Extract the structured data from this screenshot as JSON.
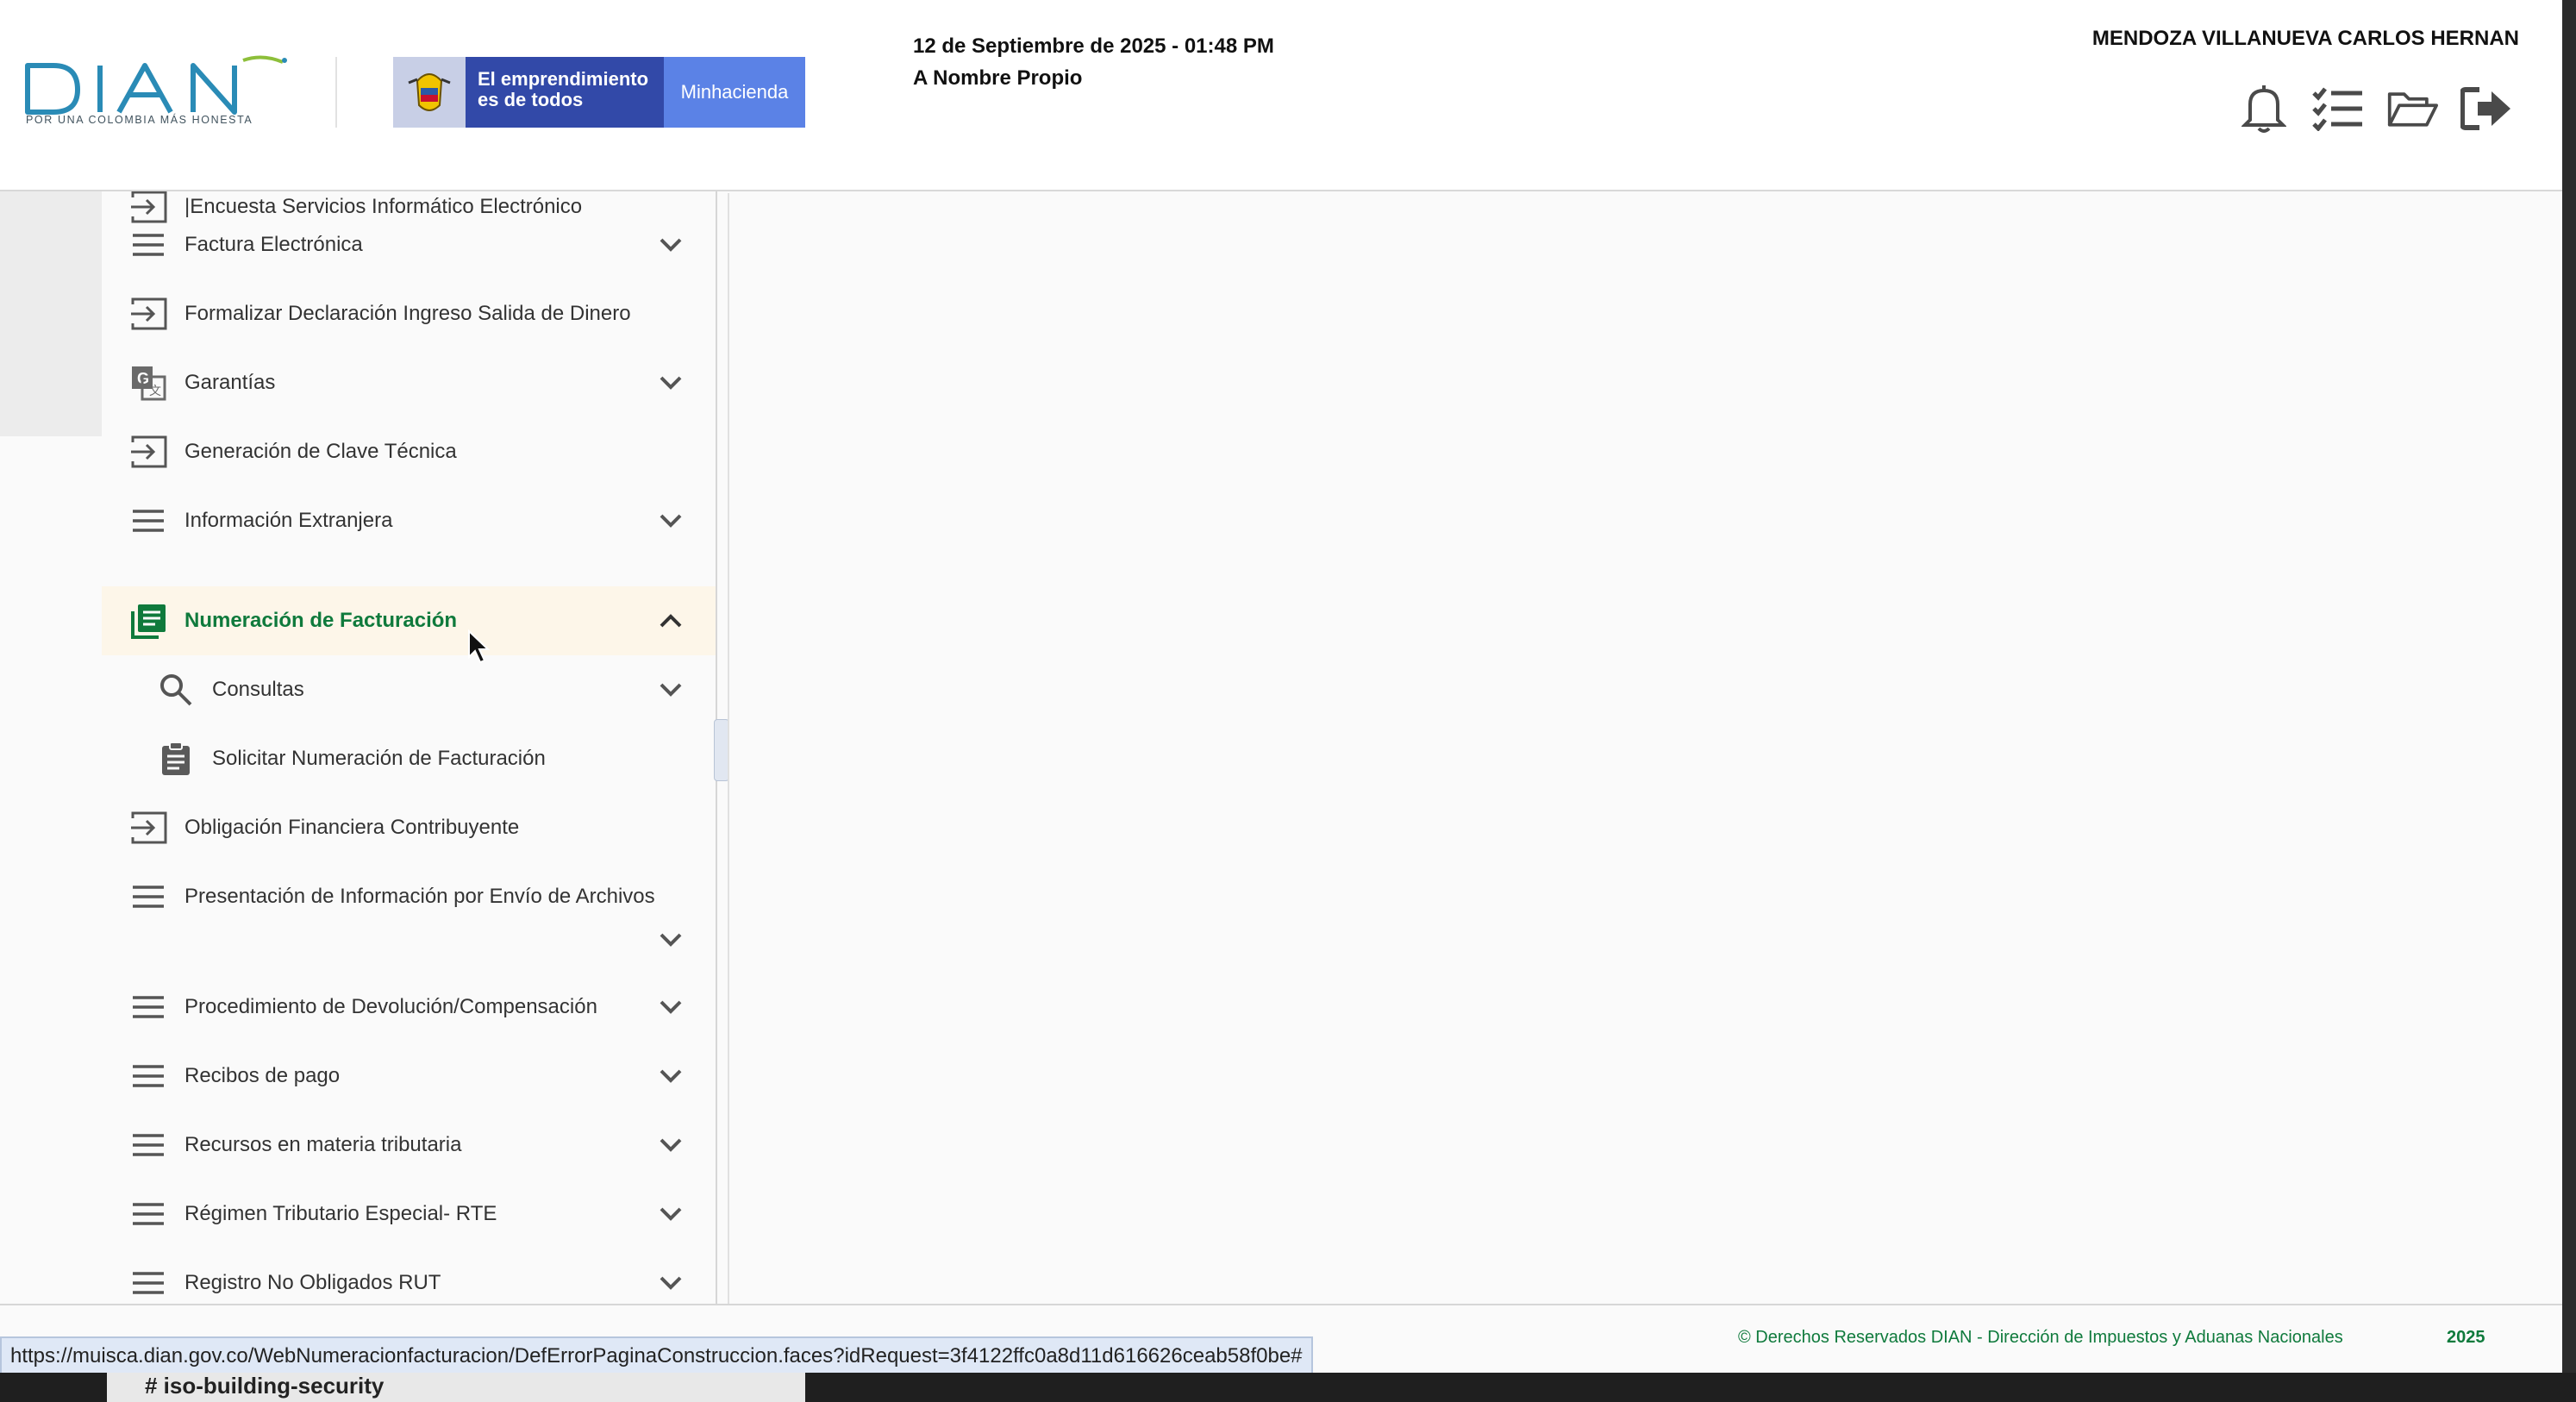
{
  "header": {
    "logo_text": "DIAN",
    "logo_tagline": "POR UNA COLOMBIA MÁS HONESTA",
    "gov_slogan_line1": "El emprendimiento",
    "gov_slogan_line2": "es de todos",
    "gov_ministry": "Minhacienda",
    "datetime": "12 de Septiembre de 2025 - 01:48 PM",
    "mode": "A Nombre Propio",
    "user_name": "MENDOZA VILLANUEVA CARLOS HERNAN",
    "icons": [
      "bell-icon",
      "task-list-icon",
      "folder-open-icon",
      "logout-icon"
    ]
  },
  "sidebar": {
    "items": [
      {
        "label": "|Encuesta Servicios Informático Electrónico",
        "icon": "login-arrow-icon",
        "expandable": false
      },
      {
        "label": "Factura Electrónica",
        "icon": "menu-lines-icon",
        "expandable": true
      },
      {
        "label": "Formalizar Declaración Ingreso Salida de Dinero",
        "icon": "login-arrow-icon",
        "expandable": false
      },
      {
        "label": "Garantías",
        "icon": "translate-icon",
        "expandable": true
      },
      {
        "label": "Generación de Clave Técnica",
        "icon": "login-arrow-icon",
        "expandable": false
      },
      {
        "label": "Información Extranjera",
        "icon": "menu-lines-icon",
        "expandable": true
      },
      {
        "label": "Numeración de Facturación",
        "icon": "library-books-icon",
        "expandable": true,
        "expanded": true
      },
      {
        "label": "Consultas",
        "icon": "search-icon",
        "expandable": true,
        "sub": true
      },
      {
        "label": "Solicitar Numeración de Facturación",
        "icon": "clipboard-icon",
        "expandable": false,
        "sub": true
      },
      {
        "label": "Obligación Financiera Contribuyente",
        "icon": "login-arrow-icon",
        "expandable": false
      },
      {
        "label": "Presentación de Información por Envío de Archivos",
        "icon": "menu-lines-icon",
        "expandable": true
      },
      {
        "label": "Procedimiento de Devolución/Compensación",
        "icon": "menu-lines-icon",
        "expandable": true
      },
      {
        "label": "Recibos de pago",
        "icon": "menu-lines-icon",
        "expandable": true
      },
      {
        "label": "Recursos en materia tributaria",
        "icon": "menu-lines-icon",
        "expandable": true
      },
      {
        "label": "Régimen Tributario Especial- RTE",
        "icon": "menu-lines-icon",
        "expandable": true
      },
      {
        "label": "Registro No Obligados RUT",
        "icon": "menu-lines-icon",
        "expandable": true
      }
    ]
  },
  "footer": {
    "copyright": "© Derechos Reservados DIAN - Dirección de Impuestos y Aduanas Nacionales",
    "year": "2025"
  },
  "status_bar": {
    "url": "https://muisca.dian.gov.co/WebNumeracionfacturacion/DefErrorPaginaConstruccion.faces?idRequest=3f4122ffc0a8d11d616626ceab58f0be#"
  },
  "background_window": {
    "text": "#   iso-building-security"
  },
  "colors": {
    "active_green": "#0f7a3c",
    "active_bg": "#fdf6e9",
    "gov_blue": "#3249a8",
    "gov_light_blue": "#5b82e6",
    "dian_logo_blue": "#2a8bb6"
  }
}
